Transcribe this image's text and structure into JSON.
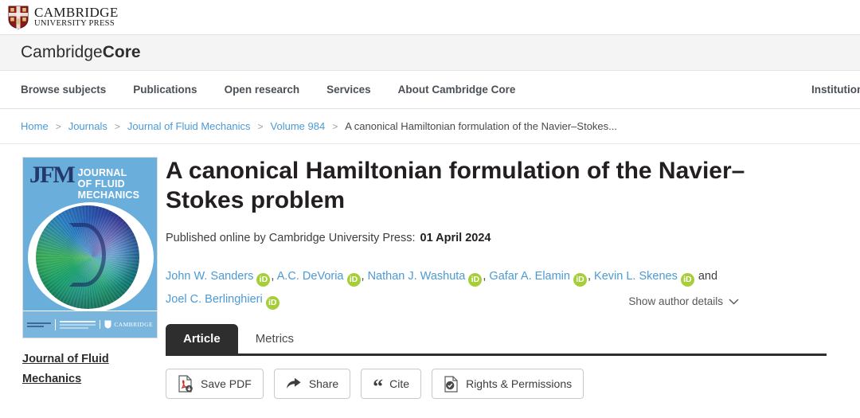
{
  "brand": {
    "name_line1": "CAMBRIDGE",
    "name_line2": "UNIVERSITY PRESS",
    "shield_color": "#8c1919"
  },
  "core_header": {
    "title_light": "Cambridge",
    "title_bold": "Core"
  },
  "nav": {
    "items": [
      {
        "label": "Browse subjects"
      },
      {
        "label": "Publications"
      },
      {
        "label": "Open research"
      },
      {
        "label": "Services"
      },
      {
        "label": "About Cambridge Core"
      }
    ],
    "right_item": "Institution lo"
  },
  "breadcrumb": {
    "items": [
      {
        "label": "Home",
        "link": true
      },
      {
        "label": "Journals",
        "link": true
      },
      {
        "label": "Journal of Fluid Mechanics",
        "link": true
      },
      {
        "label": "Volume 984",
        "link": true
      },
      {
        "label": "A canonical Hamiltonian formulation of the Navier–Stokes...",
        "link": false
      }
    ],
    "separator": ">"
  },
  "cover": {
    "mark": "JFM",
    "journal_line1": "JOURNAL",
    "journal_line2": "OF FLUID",
    "journal_line3": "MECHANICS",
    "footer_publisher": "CAMBRIDGE",
    "background_color": "#6aaedb",
    "mark_color": "#25386b"
  },
  "sidebar": {
    "journal_link_line1": "Journal of Fluid",
    "journal_link_line2": "Mechanics"
  },
  "article": {
    "title": "A canonical Hamiltonian formulation of the Navier–Stokes problem",
    "published_label": "Published online by Cambridge University Press:",
    "published_date": "01 April 2024",
    "authors": [
      {
        "name": "John W. Sanders",
        "orcid": "iD",
        "trailing": ","
      },
      {
        "name": "A.C. DeVoria",
        "orcid": "iD",
        "trailing": ","
      },
      {
        "name": "Nathan J. Washuta",
        "orcid": "iD",
        "trailing": ","
      },
      {
        "name": "Gafar A. Elamin",
        "orcid": "iD",
        "trailing": ","
      },
      {
        "name": "Kevin L. Skenes",
        "orcid": "iD",
        "trailing": " and "
      },
      {
        "name": "Joel C. Berlinghieri",
        "orcid": "iD",
        "trailing": ""
      }
    ],
    "show_author_details": "Show author details",
    "chevron": "⌄"
  },
  "tabs": [
    {
      "label": "Article",
      "active": true
    },
    {
      "label": "Metrics",
      "active": false
    }
  ],
  "actions": [
    {
      "label": "Save PDF",
      "icon": "pdf-download-icon"
    },
    {
      "label": "Share",
      "icon": "share-arrow-icon"
    },
    {
      "label": "Cite",
      "icon": "quote-icon"
    },
    {
      "label": "Rights & Permissions",
      "icon": "document-check-icon"
    }
  ],
  "colors": {
    "link_blue": "#4c9ad4",
    "orcid_green": "#a6ce39",
    "tab_dark": "#2e2e2e"
  }
}
